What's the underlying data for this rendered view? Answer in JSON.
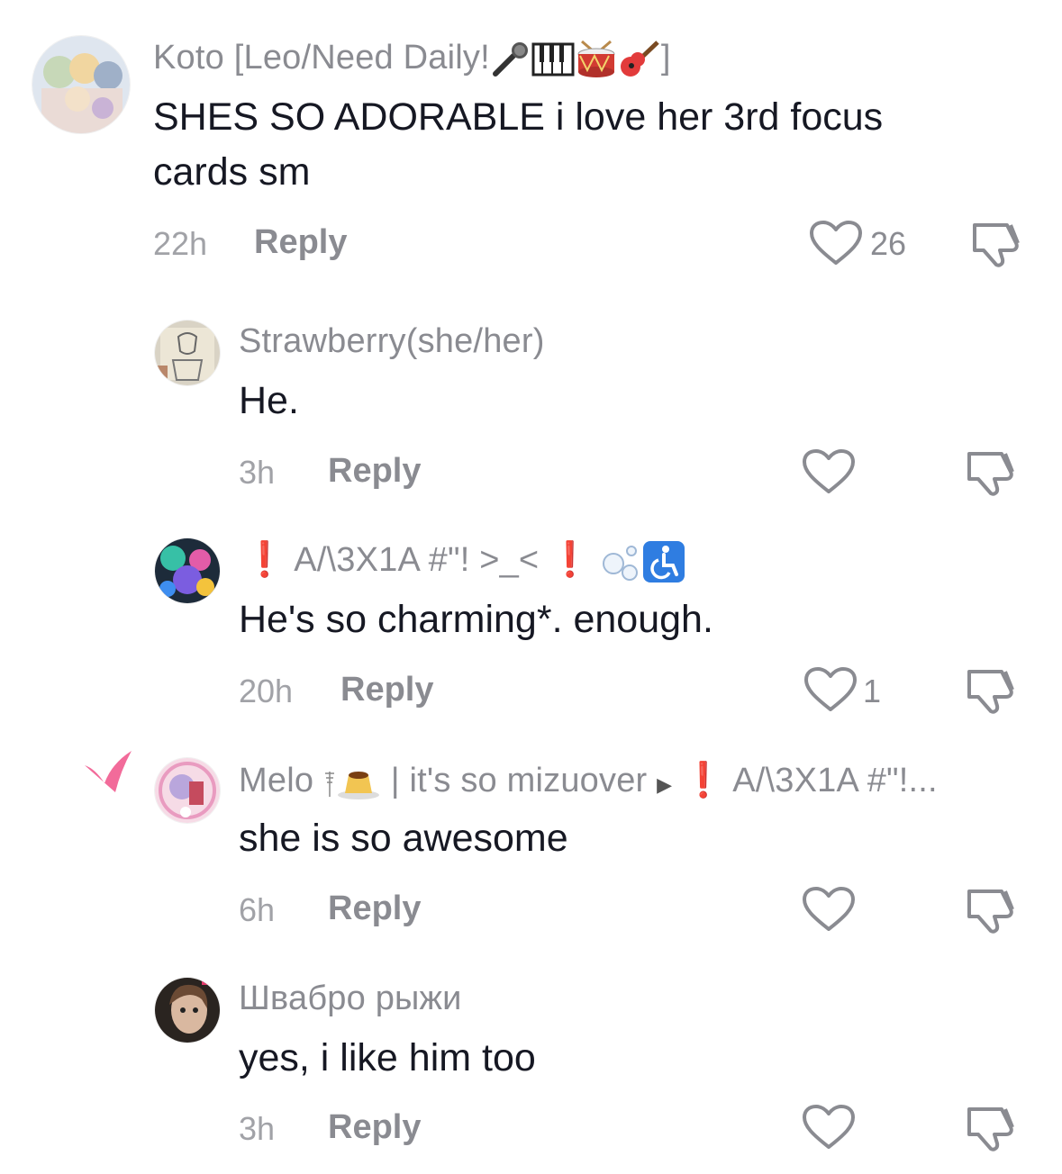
{
  "comments": [
    {
      "username": "Koto [Leo/Need Daily!",
      "username_suffix": "]",
      "text_line1": "SHES SO ADORABLE i love her 3rd focus",
      "text_line2": "cards sm",
      "time": "22h",
      "reply_label": "Reply",
      "likes": "26",
      "avatar_icon": "anime-group-avatar"
    },
    {
      "username": "Strawberry(she/her)",
      "text": "He.",
      "time": "3h",
      "reply_label": "Reply",
      "avatar_icon": "sketch-avatar"
    },
    {
      "username_prefix": "❗",
      "username": "A/\\3X1A #\"! >_<",
      "username_suffix": "❗",
      "text": "He's so charming*. enough.",
      "time": "20h",
      "reply_label": "Reply",
      "likes": "1",
      "avatar_icon": "colorful-art-avatar"
    },
    {
      "username": "Melo",
      "username_mid": "| it's so mizuover",
      "reply_to_prefix": "❗",
      "reply_to": "A/\\3X1A #\"!...",
      "text": "she is so awesome",
      "time": "6h",
      "reply_label": "Reply",
      "avatar_icon": "pink-anime-avatar"
    },
    {
      "username": "Швабро рыжи",
      "text": "yes, i like him too",
      "time": "3h",
      "reply_label": "Reply",
      "avatar_icon": "photo-avatar"
    }
  ],
  "colors": {
    "text": "#161823",
    "secondary": "#8a8b91",
    "accent_red": "#e0241b",
    "creator_heart": "#f26b9a"
  }
}
